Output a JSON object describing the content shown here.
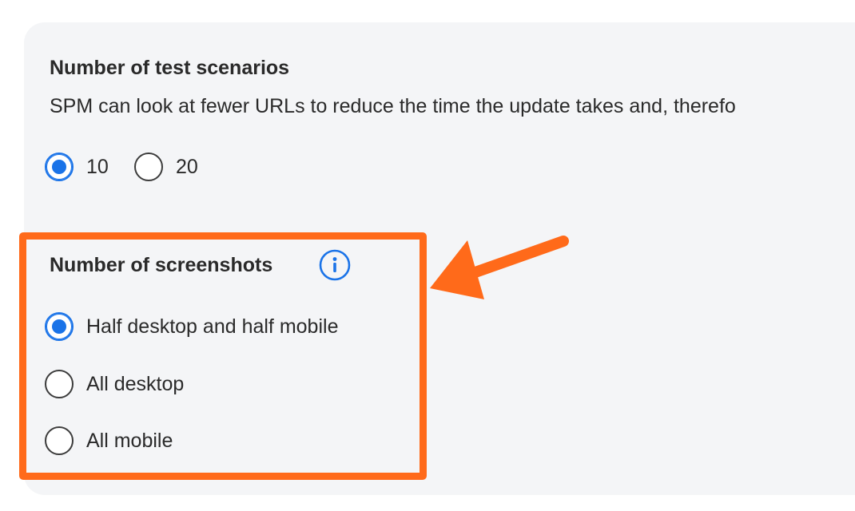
{
  "test_scenarios": {
    "title": "Number of test scenarios",
    "description": "SPM can look at fewer URLs to reduce the time the update takes and, therefo",
    "options": [
      {
        "label": "10",
        "checked": true
      },
      {
        "label": "20",
        "checked": false
      }
    ]
  },
  "screenshots": {
    "title": "Number of screenshots",
    "info_icon": "info-circle-icon",
    "options": [
      {
        "label": "Half desktop and half mobile",
        "checked": true
      },
      {
        "label": "All desktop",
        "checked": false
      },
      {
        "label": "All mobile",
        "checked": false
      }
    ]
  },
  "annotation": {
    "highlight_color": "#ff6a1a",
    "arrow_icon": "arrow-left-icon"
  },
  "colors": {
    "panel_background": "#f4f5f7",
    "radio_checked": "#1a73e8",
    "info_icon": "#1a73e8"
  }
}
